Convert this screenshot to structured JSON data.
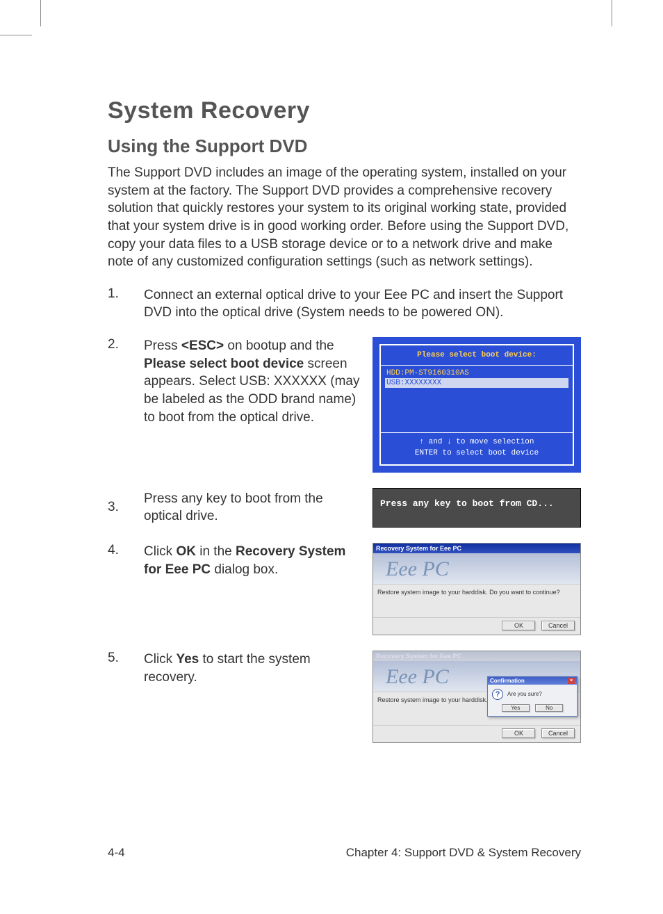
{
  "heading": "System Recovery",
  "subheading": "Using the Support DVD",
  "intro": "The Support DVD includes an image of the operating system, installed on your system at the factory. The Support DVD provides a comprehensive recovery solution that quickly restores your system to its original working state, provided that your system drive is in good working order. Before using the Support DVD, copy your data files to a USB storage device or to a network drive and make note of any customized configuration settings (such as network settings).",
  "steps": {
    "s1": {
      "num": "1.",
      "text": "Connect an external optical drive to your Eee PC and insert the Support DVD into the optical drive (System needs to be powered ON)."
    },
    "s2": {
      "num": "2.",
      "pre": "Press ",
      "b1": "<ESC>",
      "mid1": " on bootup and the ",
      "b2": "Please select boot device",
      "post": " screen appears. Select USB: XXXXXX (may be labeled as the ODD brand name) to boot from the optical drive."
    },
    "s3": {
      "num": "3.",
      "text": "Press any key to boot from the optical drive."
    },
    "s4": {
      "num": "4.",
      "pre": "Click ",
      "b1": "OK",
      "mid1": " in the ",
      "b2": "Recovery System for Eee PC",
      "post": " dialog box."
    },
    "s5": {
      "num": "5.",
      "pre": "Click ",
      "b1": "Yes",
      "post": " to start the system recovery."
    }
  },
  "boot_dialog": {
    "header": "Please select boot device:",
    "item1": "HDD:PM-ST9160310AS",
    "item2": "USB:XXXXXXXX",
    "footer1": "↑ and ↓ to move selection",
    "footer2": "ENTER to select boot device"
  },
  "press_key": "Press any key to boot from CD...",
  "recov": {
    "title": "Recovery System for Eee PC",
    "banner": "Eee PC",
    "body": "Restore system image to your harddisk. Do you want to continue?",
    "ok": "OK",
    "cancel": "Cancel"
  },
  "confirm": {
    "title": "Confirmation",
    "body": "Are you sure?",
    "yes": "Yes",
    "no": "No"
  },
  "footer": {
    "page": "4-4",
    "chapter": "Chapter 4: Support DVD & System Recovery"
  }
}
